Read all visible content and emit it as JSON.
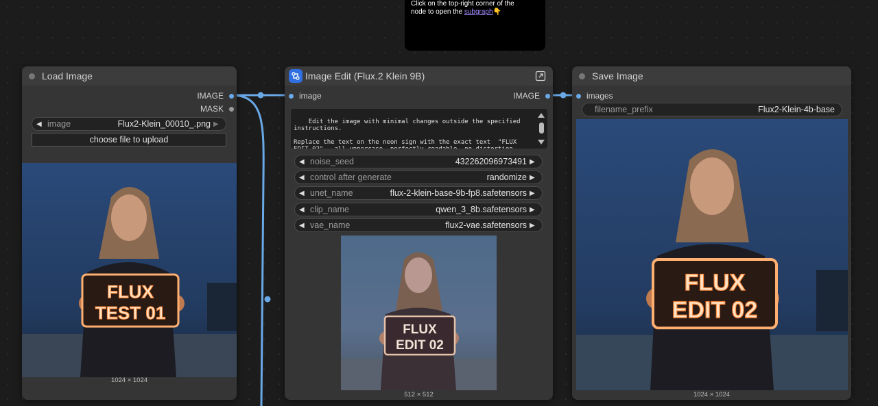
{
  "note": {
    "line1": "Click on the top-right corner of the",
    "line2_prefix": "node to open the ",
    "link": "subgraph",
    "pointer": "👇"
  },
  "load_image": {
    "title": "Load Image",
    "outputs": [
      "IMAGE",
      "MASK"
    ],
    "image_widget": {
      "label": "image",
      "value": "Flux2-Klein_00010_.png"
    },
    "upload_label": "choose file to upload",
    "sign_line1": "FLUX",
    "sign_line2": "TEST 01",
    "dims": "1024 × 1024"
  },
  "image_edit": {
    "title": "Image Edit (Flux.2 Klein 9B)",
    "input_label": "image",
    "output_label": "IMAGE",
    "prompt": "Edit the image with minimal changes outside the specified instructions.\n\nReplace the text on the neon sign with the exact text  \"FLUX EDIT 02\" , all uppercase, perfectly readable, no distortion, same sign size and position.",
    "widgets": [
      {
        "label": "noise_seed",
        "value": "432262096973491"
      },
      {
        "label": "control after generate",
        "value": "randomize"
      },
      {
        "label": "unet_name",
        "value": "flux-2-klein-base-9b-fp8.safetensors"
      },
      {
        "label": "clip_name",
        "value": "qwen_3_8b.safetensors"
      },
      {
        "label": "vae_name",
        "value": "flux2-vae.safetensors"
      }
    ],
    "sign_line1": "FLUX",
    "sign_line2": "EDIT 02",
    "dims": "512 × 512"
  },
  "save_image": {
    "title": "Save Image",
    "input_label": "images",
    "filename_widget": {
      "label": "filename_prefix",
      "value": "Flux2-Klein-4b-base"
    },
    "sign_line1": "FLUX",
    "sign_line2": "EDIT 02",
    "dims": "1024 × 1024"
  },
  "colors": {
    "wire": "#6aa9e8",
    "subgraph_badge": "#2f6fe0",
    "neon": "#ffb070"
  }
}
